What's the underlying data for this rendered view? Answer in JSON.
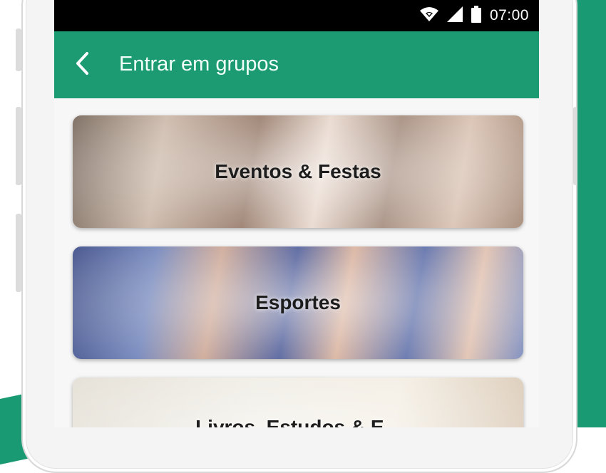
{
  "status_bar": {
    "time": "07:00"
  },
  "app_bar": {
    "title": "Entrar em grupos"
  },
  "groups": [
    {
      "label": "Eventos & Festas"
    },
    {
      "label": "Esportes"
    },
    {
      "label": "Livros, Estudos & E..."
    }
  ],
  "colors": {
    "accent": "#1c9b73",
    "status_bar": "#000000",
    "background_decor": "#1a9a72"
  },
  "icons": {
    "wifi": "wifi-icon",
    "signal": "signal-icon",
    "battery": "battery-icon",
    "back": "back-arrow-icon"
  }
}
